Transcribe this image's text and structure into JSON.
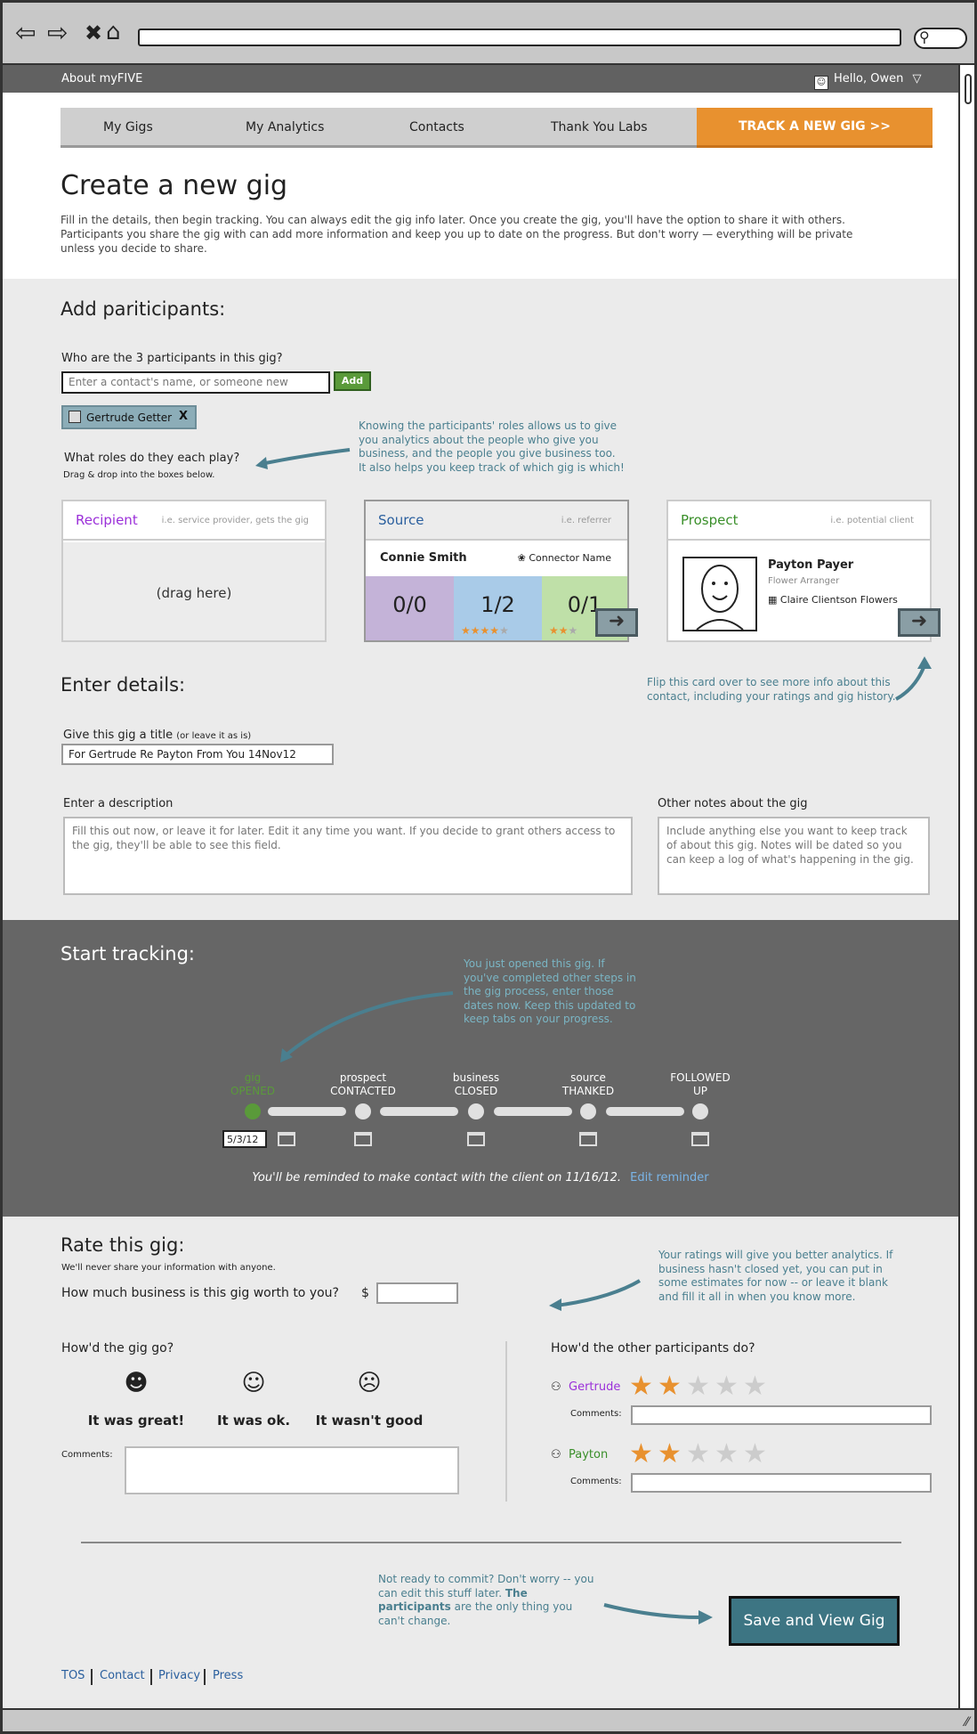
{
  "browser": {
    "back_icon": "arrow-left-icon",
    "forward_icon": "arrow-right-icon",
    "stop_icon": "close-icon",
    "home_icon": "home-icon",
    "search_icon": "search-icon"
  },
  "topbar": {
    "about": "About myFIVE",
    "user_menu": "Hello, Owen"
  },
  "tabs": {
    "my_gigs": "My Gigs",
    "my_analytics": "My Analytics",
    "contacts": "Contacts",
    "thank_you_labs": "Thank You Labs",
    "track_new": "TRACK A NEW GIG >>"
  },
  "header": {
    "title": "Create a new gig",
    "intro": "Fill in the details, then begin tracking. You can always edit the gig info later. Once you create the gig, you'll have the option to share it with others. Participants you share the gig with can add more information and keep you up to date on the progress. But don't worry — everything will be private unless you decide to share."
  },
  "participants": {
    "section_title": "Add pariticipants:",
    "question": "Who are the 3 participants in this gig?",
    "input_placeholder": "Enter a contact's name, or someone new",
    "add_label": "Add",
    "chip_label": "Gertrude Getter",
    "chip_remove": "X",
    "roles_question": "What roles do they each play?",
    "roles_hint": "Drag & drop into the boxes below.",
    "roles_note": "Knowing the participants' roles allows us to give you analytics about the people who give you business, and the people you give business too. It also helps you keep track of which gig is which!",
    "recipient": {
      "role": "Recipient",
      "hint": "i.e. service provider, gets the gig",
      "placeholder": "(drag here)"
    },
    "source": {
      "role": "Source",
      "hint": "i.e. referrer",
      "name": "Connie Smith",
      "connector": "Connector Name",
      "scores": [
        {
          "value": "0/0",
          "stars": 0
        },
        {
          "value": "1/2",
          "stars": 4
        },
        {
          "value": "0/1",
          "stars": 2
        }
      ]
    },
    "prospect": {
      "role": "Prospect",
      "hint": "i.e. potential client",
      "name": "Payton Payer",
      "title": "Flower Arranger",
      "company": "Claire Clientson Flowers"
    },
    "flip_note": "Flip this card over to see more info about this contact, including your ratings and gig history."
  },
  "details": {
    "section_title": "Enter details:",
    "title_label": "Give this gig a title",
    "title_label_suffix": "(or leave it as is)",
    "title_value": "For Gertrude Re Payton From You 14Nov12",
    "desc_label": "Enter a description",
    "desc_placeholder": "Fill this out now, or leave it for later. Edit it any time you want. If you decide to grant others access to the gig, they'll be able to see this field.",
    "notes_label": "Other notes about the gig",
    "notes_placeholder": "Include anything else you want to keep track of about this gig. Notes will be dated so you can keep a log of what's happening in the gig."
  },
  "tracking": {
    "section_title": "Start tracking:",
    "note": "You just opened this gig. If you've completed other steps in the gig process, enter those dates now. Keep this updated to keep tabs on your progress.",
    "steps": [
      {
        "top": "gig",
        "bottom": "OPENED"
      },
      {
        "top": "prospect",
        "bottom": "CONTACTED"
      },
      {
        "top": "business",
        "bottom": "CLOSED"
      },
      {
        "top": "source",
        "bottom": "THANKED"
      },
      {
        "top": "FOLLOWED",
        "bottom": "UP"
      }
    ],
    "opened_date": "5/3/12",
    "reminder": "You'll be reminded to make contact with the client on 11/16/12.",
    "edit_reminder": "Edit reminder"
  },
  "rating": {
    "section_title": "Rate this gig:",
    "privacy": "We'll never share your information with anyone.",
    "worth_question": "How much business is this gig worth to you?",
    "currency": "$",
    "worth_value": "",
    "note": "Your ratings will give you better analytics. If business hasn't closed yet, you can put in some estimates for now -- or leave it blank and fill it all in when you know more.",
    "how_went": "How'd the gig go?",
    "faces": [
      {
        "icon": "happy-face-icon",
        "label": "It was great!"
      },
      {
        "icon": "neutral-face-icon",
        "label": "It was ok."
      },
      {
        "icon": "sad-face-icon",
        "label": "It wasn't good"
      }
    ],
    "comments_label": "Comments:",
    "others_question": "How'd the other participants do?",
    "others": [
      {
        "name": "Gertrude",
        "color": "#9b30d9",
        "stars": 2,
        "max": 5
      },
      {
        "name": "Payton",
        "color": "#3a8f2a",
        "stars": 2,
        "max": 5
      }
    ]
  },
  "save": {
    "note_plain": "Not ready to commit? Don't worry -- you can edit this stuff later.",
    "note_bold": "The participants",
    "note_tail": "are the only thing you can't change.",
    "button": "Save and View Gig"
  },
  "footer": {
    "links": [
      "TOS",
      "Contact",
      "Privacy",
      "Press"
    ]
  },
  "colors": {
    "accent_orange": "#e8912f",
    "teal": "#4a7f8f",
    "green": "#5a9a3a",
    "dark_band": "#666666"
  }
}
